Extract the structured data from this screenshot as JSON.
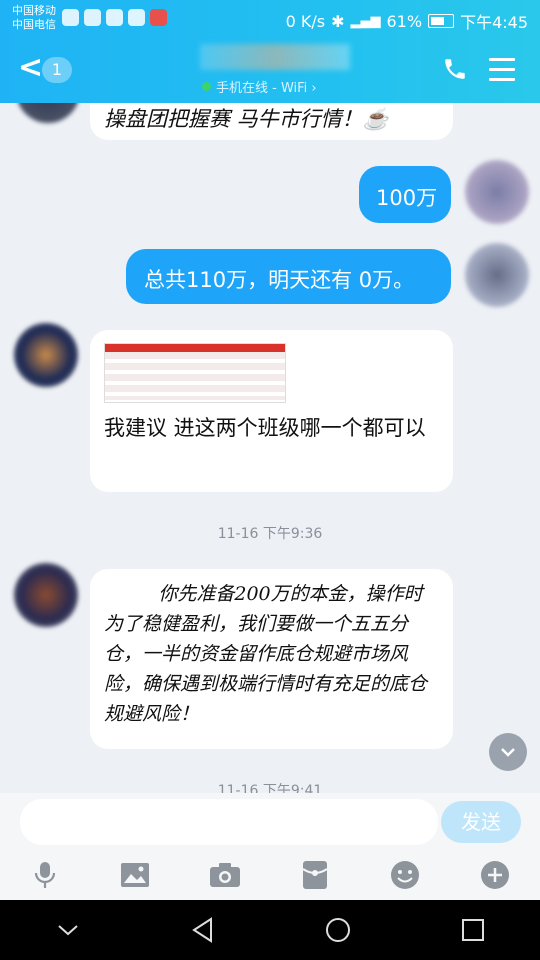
{
  "status_bar": {
    "carrier1": "中国移动",
    "carrier2": "中国电信",
    "net_speed": "0 K/s",
    "battery_percent": "61%",
    "time": "下午4:45"
  },
  "header": {
    "unread_count": "1",
    "online_status": "手机在线 - WiFi ›"
  },
  "messages": [
    {
      "side": "in",
      "text": "操盘团把握赛 马牛市行情！☕"
    },
    {
      "side": "out",
      "text": "100万"
    },
    {
      "side": "out",
      "text": "总共110万，明天还有 0万。"
    },
    {
      "side": "in",
      "text": "我建议       进这两个班级哪一个都可以"
    },
    {
      "type": "timestamp",
      "text": "11-16 下午9:36"
    },
    {
      "side": "in",
      "text": "         你先准备200万的本金，操作时为了稳健盈利，我们要做一个五五分仓，一半的资金留作底仓规避市场风险，确保遇到极端行情时有充足的底仓规避风险！"
    },
    {
      "type": "timestamp",
      "text": "11-16 下午9:41"
    }
  ],
  "input": {
    "placeholder": "",
    "send_label": "发送"
  },
  "colors": {
    "header_blue": "#1fb3f5",
    "out_bubble": "#1ea4f8",
    "send_disabled": "#bfe5fb"
  }
}
